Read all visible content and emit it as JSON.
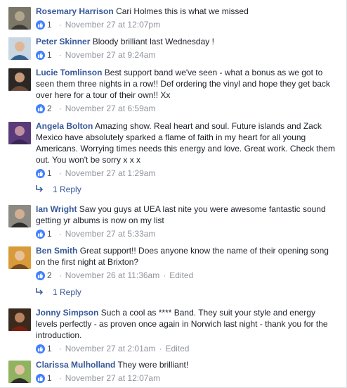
{
  "comments": [
    {
      "author": "Rosemary Harrison",
      "text": "Cari Holmes this is what we missed",
      "likes": "1",
      "time": "November 27 at 12:07pm",
      "edited": "",
      "avatar": "person-icon"
    },
    {
      "author": "Peter Skinner",
      "text": "Bloody brilliant last Wednesday !",
      "likes": "1",
      "time": "November 27 at 9:24am",
      "edited": "",
      "avatar": "person-icon"
    },
    {
      "author": "Lucie Tomlinson",
      "text": "Best support band we've seen - what a bonus as we got to seen them three nights in a row!! Def ordering the vinyl and hope they get back over here for a tour of their own!! Xx",
      "likes": "2",
      "time": "November 27 at 6:59am",
      "edited": "",
      "avatar": "person-icon"
    },
    {
      "author": "Angela Bolton",
      "text": "Amazing show. Real heart and soul. Future islands and Zack Mexico have absolutely sparked a flame of faith in my heart for all young Americans. Worrying times needs this energy and love. Great work. Check them out. You won't be sorry x x x",
      "likes": "1",
      "time": "November 27 at 1:29am",
      "edited": "",
      "avatar": "person-icon"
    },
    {
      "author": "Ian Wright",
      "text": "Saw you guys at UEA last nite you were awesome fantastic sound getting yr albums is now on my list",
      "likes": "1",
      "time": "November 27 at 5:33am",
      "edited": "",
      "avatar": "person-icon"
    },
    {
      "author": "Ben Smith",
      "text": "Great support!! Does anyone know the name of their opening song on the first night at Brixton?",
      "likes": "2",
      "time": "November 26 at 11:36am",
      "edited": "Edited",
      "avatar": "person-icon"
    },
    {
      "author": "Jonny Simpson",
      "text": "Such a cool as **** Band. They suit your style and energy levels perfectly - as proven once again in Norwich last night - thank you for the introduction.",
      "likes": "1",
      "time": "November 27 at 2:01am",
      "edited": "Edited",
      "avatar": "person-icon"
    },
    {
      "author": "Clarissa Mulholland",
      "text": "They were brilliant!",
      "likes": "1",
      "time": "November 27 at 12:07am",
      "edited": "",
      "avatar": "person-icon"
    }
  ],
  "replies": [
    {
      "label": "1 Reply"
    },
    {
      "label": "1 Reply"
    }
  ],
  "separator": "·",
  "colors": {
    "link": "#365899",
    "meta": "#90949c",
    "like": "#4080ff"
  }
}
